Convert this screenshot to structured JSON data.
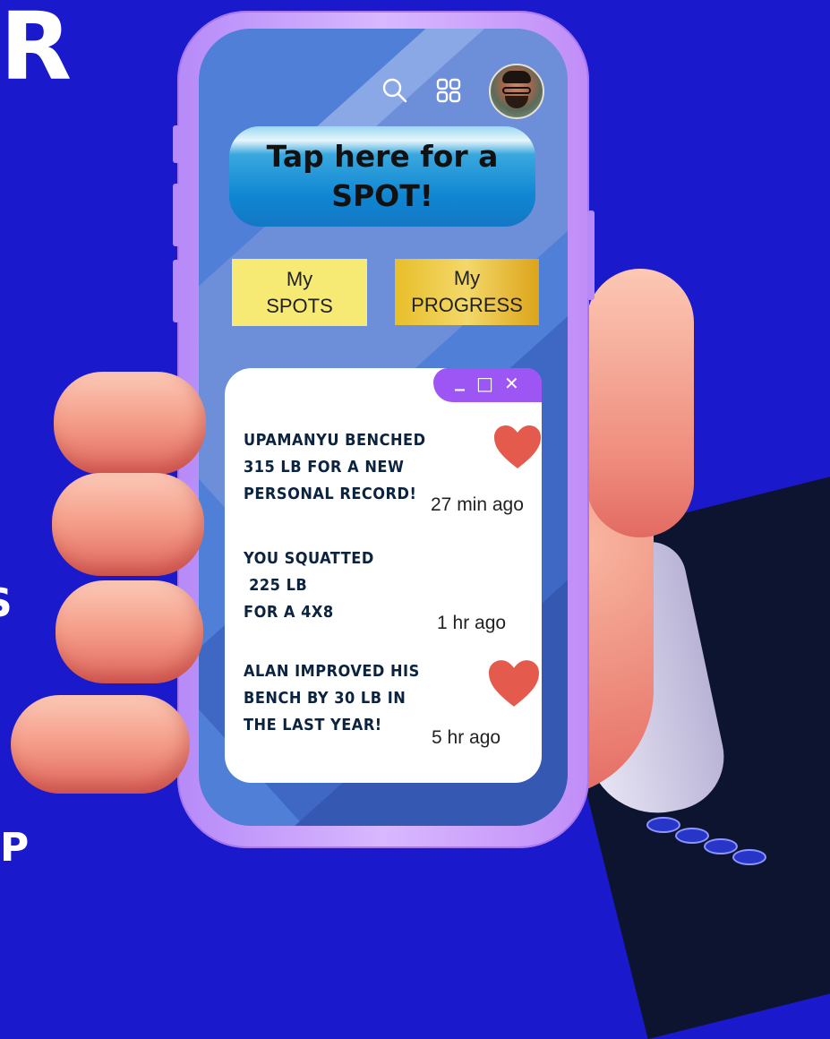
{
  "edge": {
    "top_right_fragment": "R",
    "left_fragment": "S",
    "bottom_fragment": "P"
  },
  "header": {
    "search_icon": "search-icon",
    "grid_icon": "grid-icon",
    "avatar": "user-avatar"
  },
  "spot_button": {
    "line1": "Tap here for a",
    "line2": "SPOT!"
  },
  "tiles": [
    {
      "line1": "My",
      "line2": "SPOTS"
    },
    {
      "line1": "My",
      "line2": "PROGRESS"
    }
  ],
  "window_controls": {
    "minimize": "_",
    "maximize": "□",
    "close": "✕"
  },
  "feed": [
    {
      "lines": [
        "Upamanyu benched",
        "315 lb for a new",
        "Personal Record!"
      ],
      "time": "27 min ago",
      "liked": true
    },
    {
      "lines": [
        "You squatted",
        " 225 lb",
        "for a 4x8"
      ],
      "time": "1 hr ago",
      "liked": false
    },
    {
      "lines": [
        "Alan improved his",
        "bench by 30 lb in",
        "the last year!"
      ],
      "time": "5 hr ago",
      "liked": true
    }
  ],
  "colors": {
    "background": "#1a1acc",
    "heart": "#e45a4c",
    "window_bar": "#9d56f3",
    "feed_text": "#0c2340"
  }
}
